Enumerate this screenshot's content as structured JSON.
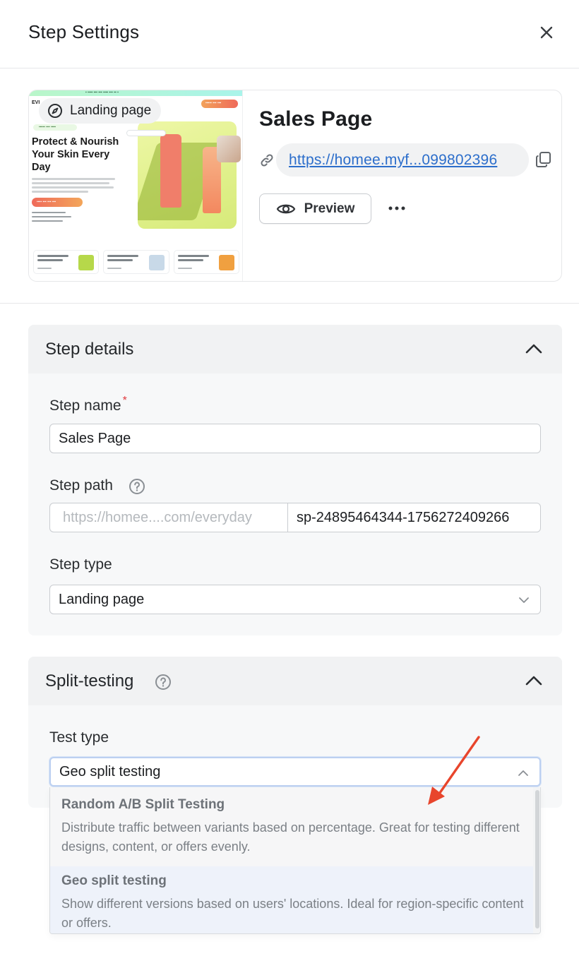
{
  "header": {
    "title": "Step Settings",
    "close_icon": "close-icon"
  },
  "page_card": {
    "thumbnail": {
      "badge_label": "Landing page",
      "badge_icon": "compass-icon",
      "logo": "EVI",
      "headline": "Protect & Nourish Your Skin Every Day"
    },
    "title": "Sales Page",
    "url": "https://homee.myf...099802396",
    "link_icon": "link-icon",
    "copy_icon": "copy-icon",
    "preview_label": "Preview",
    "preview_icon": "eye-icon",
    "more_icon": "more-horizontal-icon"
  },
  "step_details": {
    "title": "Step details",
    "step_name": {
      "label": "Step name",
      "required_mark": "*",
      "value": "Sales Page"
    },
    "step_path": {
      "label": "Step path",
      "prefix": "https://homee....com/everyday",
      "value": "sp-24895464344-1756272409266"
    },
    "step_type": {
      "label": "Step type",
      "value": "Landing page"
    }
  },
  "split_testing": {
    "title": "Split-testing",
    "test_type": {
      "label": "Test type",
      "value": "Geo split testing",
      "options": [
        {
          "title": "Random A/B Split Testing",
          "description": "Distribute traffic between variants based on percentage. Great for testing different designs, content, or offers evenly."
        },
        {
          "title": "Geo split testing",
          "description": "Show different versions based on users' locations. Ideal for region-specific content or offers."
        }
      ]
    }
  },
  "colors": {
    "link": "#2c6ecb",
    "required": "#e0383e",
    "annotation_arrow": "#e8452c",
    "selected_option_bg": "#eef2fa"
  }
}
